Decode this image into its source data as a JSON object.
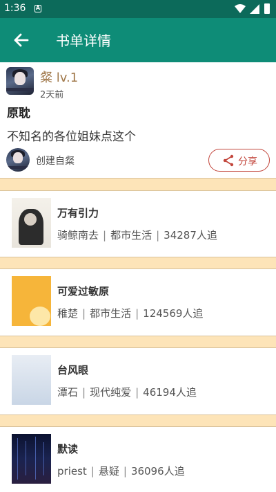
{
  "status_bar": {
    "time": "1:36",
    "notification_icon": "notification-a-icon",
    "wifi_icon": "wifi-icon",
    "signal_icon": "signal-icon",
    "battery_icon": "battery-icon"
  },
  "app_bar": {
    "title": "书单详情",
    "back_icon": "arrow-back-icon",
    "color": "#0e8c77"
  },
  "header": {
    "user_name": "粲  lv.1",
    "time_ago": "2天前",
    "list_title": "原耽",
    "description": "不知名的各位姐妹点这个",
    "creator_label": "创建自粲",
    "share_label": "分享",
    "share_icon": "share-icon",
    "accent_color": "#c2453b"
  },
  "books": [
    {
      "title": "万有引力",
      "author": "骑鲸南去",
      "category": "都市生活",
      "followers": "34287人追"
    },
    {
      "title": "可爱过敏原",
      "author": "稚楚",
      "category": "都市生活",
      "followers": "124569人追"
    },
    {
      "title": "台风眼",
      "author": "潭石",
      "category": "现代纯爱",
      "followers": "46194人追"
    },
    {
      "title": "默读",
      "author": "priest",
      "category": "悬疑",
      "followers": "36096人追"
    }
  ],
  "colors": {
    "separator": "#fde4b8",
    "status_bar": "#0c6a5a"
  }
}
